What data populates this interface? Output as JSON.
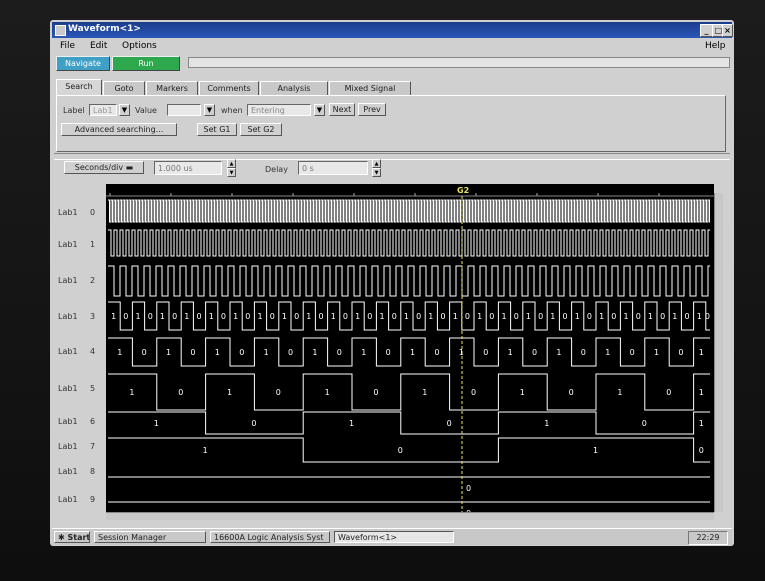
{
  "window": {
    "title": "Waveform<1>"
  },
  "menu": {
    "file": "File",
    "edit": "Edit",
    "options": "Options",
    "help": "Help"
  },
  "mode": {
    "navigate": "Navigate",
    "run": "Run"
  },
  "tabs": [
    "Search",
    "Goto",
    "Markers",
    "Comments",
    "Analysis",
    "Mixed Signal"
  ],
  "search": {
    "label_caption": "Label",
    "label_value": "Lab1",
    "value_caption": "Value",
    "value_value": "",
    "when_caption": "when",
    "when_value": "Entering",
    "next_label": "Next",
    "prev_label": "Prev",
    "advanced_label": "Advanced searching...",
    "setg1_label": "Set G1",
    "setg2_label": "Set G2"
  },
  "timebase": {
    "units": "Seconds/div",
    "value": "1.000 us",
    "delay_caption": "Delay",
    "delay_value": "0 s"
  },
  "marker": {
    "label": "G2"
  },
  "rows": [
    {
      "label": "Lab1",
      "bit": "0"
    },
    {
      "label": "Lab1",
      "bit": "1"
    },
    {
      "label": "Lab1",
      "bit": "2"
    },
    {
      "label": "Lab1",
      "bit": "3"
    },
    {
      "label": "Lab1",
      "bit": "4"
    },
    {
      "label": "Lab1",
      "bit": "5"
    },
    {
      "label": "Lab1",
      "bit": "6"
    },
    {
      "label": "Lab1",
      "bit": "7"
    },
    {
      "label": "Lab1",
      "bit": "8"
    },
    {
      "label": "Lab1",
      "bit": "9"
    }
  ],
  "taskbar": {
    "start": "Start",
    "items": [
      "Session Manager",
      "16600A Logic Analysis Syst",
      "Waveform<1>"
    ],
    "clock": "22:29"
  },
  "colors": {
    "title": "#1f47a0",
    "navigate": "#3f9fc4",
    "run": "#2da84c",
    "marker": "#e7e55a",
    "trace": "#ffffff"
  }
}
